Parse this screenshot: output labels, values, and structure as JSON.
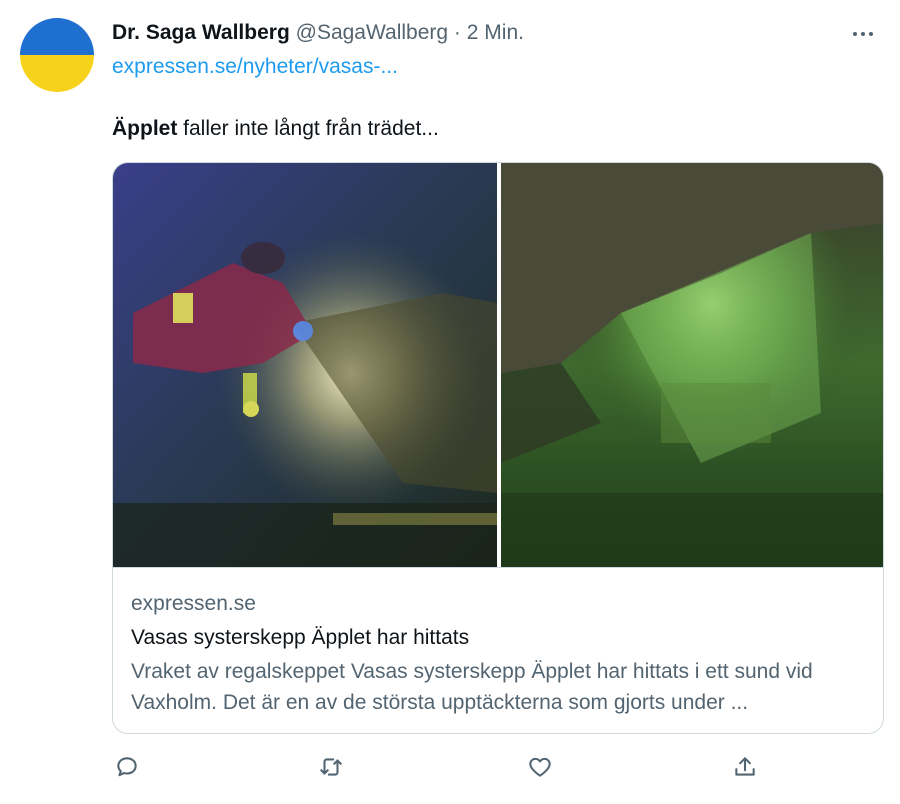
{
  "author": {
    "display_name": "Dr. Saga Wallberg",
    "handle": "@SagaWallberg",
    "separator": "·",
    "time": "2 Min.",
    "avatar_colors": [
      "#1f6fd1",
      "#f7d21a"
    ]
  },
  "tweet": {
    "link_text": "expressen.se/nyheter/vasas-...",
    "text_bold": "Äpplet",
    "text_rest": " faller inte långt från trädet..."
  },
  "card": {
    "domain": "expressen.se",
    "title": "Vasas systerskepp Äpplet har hittats",
    "description": "Vraket av regalskeppet Vasas systerskepp Äpplet har hittats i ett sund vid Vaxholm. Det är en av de största upptäckterna som gjorts under ..."
  },
  "actions": {
    "icons": [
      "reply-icon",
      "retweet-icon",
      "like-icon",
      "share-icon"
    ]
  },
  "colors": {
    "link": "#1d9bf0",
    "secondary_text": "#536471",
    "border": "#cfd9de"
  }
}
